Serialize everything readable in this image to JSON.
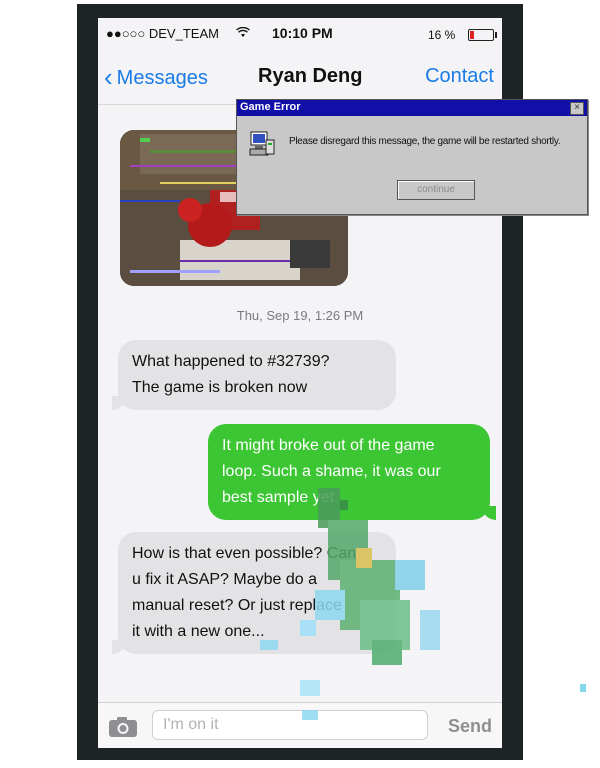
{
  "status": {
    "carrier": "●●○○○ DEV_TEAM",
    "wifi_icon": "wifi-icon",
    "time": "10:10 PM",
    "battery": "16 %",
    "battery_level": 0.16
  },
  "nav": {
    "back_label": "Messages",
    "title": "Ryan Deng",
    "contact_label": "Contact"
  },
  "thread": {
    "timestamp": "Thu, Sep 19, 1:26 PM",
    "messages": [
      {
        "direction": "incoming",
        "lines": [
          "What happened to #32739?",
          "The game is broken now"
        ]
      },
      {
        "direction": "outgoing",
        "lines": [
          "It might broke out of the game",
          "loop. Such a shame, it was our",
          "best sample yet."
        ]
      },
      {
        "direction": "incoming",
        "lines": [
          "How is that even possible? Can",
          "u fix it ASAP? Maybe do a",
          "manual reset? Or just replace",
          "it with a new one..."
        ]
      }
    ]
  },
  "composer": {
    "value": "I'm on it",
    "send_label": "Send",
    "camera_icon": "camera-icon"
  },
  "dialog": {
    "title": "Game Error",
    "message": "Please disregard this message, the game will be restarted shortly.",
    "button_label": "continue"
  },
  "colors": {
    "ios_blue": "#1a7be6",
    "outgoing_green": "#3dc634",
    "incoming_gray": "#e3e3e6",
    "dialog_title_blue": "#1010a8"
  }
}
